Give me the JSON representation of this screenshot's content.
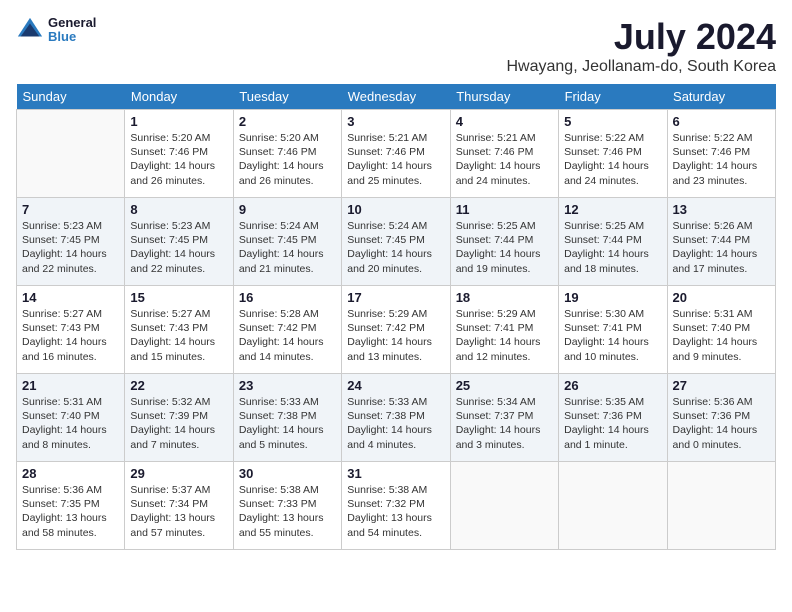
{
  "logo": {
    "line1": "General",
    "line2": "Blue"
  },
  "title": "July 2024",
  "location": "Hwayang, Jeollanam-do, South Korea",
  "weekdays": [
    "Sunday",
    "Monday",
    "Tuesday",
    "Wednesday",
    "Thursday",
    "Friday",
    "Saturday"
  ],
  "weeks": [
    [
      {
        "day": "",
        "info": ""
      },
      {
        "day": "1",
        "info": "Sunrise: 5:20 AM\nSunset: 7:46 PM\nDaylight: 14 hours\nand 26 minutes."
      },
      {
        "day": "2",
        "info": "Sunrise: 5:20 AM\nSunset: 7:46 PM\nDaylight: 14 hours\nand 26 minutes."
      },
      {
        "day": "3",
        "info": "Sunrise: 5:21 AM\nSunset: 7:46 PM\nDaylight: 14 hours\nand 25 minutes."
      },
      {
        "day": "4",
        "info": "Sunrise: 5:21 AM\nSunset: 7:46 PM\nDaylight: 14 hours\nand 24 minutes."
      },
      {
        "day": "5",
        "info": "Sunrise: 5:22 AM\nSunset: 7:46 PM\nDaylight: 14 hours\nand 24 minutes."
      },
      {
        "day": "6",
        "info": "Sunrise: 5:22 AM\nSunset: 7:46 PM\nDaylight: 14 hours\nand 23 minutes."
      }
    ],
    [
      {
        "day": "7",
        "info": "Sunrise: 5:23 AM\nSunset: 7:45 PM\nDaylight: 14 hours\nand 22 minutes."
      },
      {
        "day": "8",
        "info": "Sunrise: 5:23 AM\nSunset: 7:45 PM\nDaylight: 14 hours\nand 22 minutes."
      },
      {
        "day": "9",
        "info": "Sunrise: 5:24 AM\nSunset: 7:45 PM\nDaylight: 14 hours\nand 21 minutes."
      },
      {
        "day": "10",
        "info": "Sunrise: 5:24 AM\nSunset: 7:45 PM\nDaylight: 14 hours\nand 20 minutes."
      },
      {
        "day": "11",
        "info": "Sunrise: 5:25 AM\nSunset: 7:44 PM\nDaylight: 14 hours\nand 19 minutes."
      },
      {
        "day": "12",
        "info": "Sunrise: 5:25 AM\nSunset: 7:44 PM\nDaylight: 14 hours\nand 18 minutes."
      },
      {
        "day": "13",
        "info": "Sunrise: 5:26 AM\nSunset: 7:44 PM\nDaylight: 14 hours\nand 17 minutes."
      }
    ],
    [
      {
        "day": "14",
        "info": "Sunrise: 5:27 AM\nSunset: 7:43 PM\nDaylight: 14 hours\nand 16 minutes."
      },
      {
        "day": "15",
        "info": "Sunrise: 5:27 AM\nSunset: 7:43 PM\nDaylight: 14 hours\nand 15 minutes."
      },
      {
        "day": "16",
        "info": "Sunrise: 5:28 AM\nSunset: 7:42 PM\nDaylight: 14 hours\nand 14 minutes."
      },
      {
        "day": "17",
        "info": "Sunrise: 5:29 AM\nSunset: 7:42 PM\nDaylight: 14 hours\nand 13 minutes."
      },
      {
        "day": "18",
        "info": "Sunrise: 5:29 AM\nSunset: 7:41 PM\nDaylight: 14 hours\nand 12 minutes."
      },
      {
        "day": "19",
        "info": "Sunrise: 5:30 AM\nSunset: 7:41 PM\nDaylight: 14 hours\nand 10 minutes."
      },
      {
        "day": "20",
        "info": "Sunrise: 5:31 AM\nSunset: 7:40 PM\nDaylight: 14 hours\nand 9 minutes."
      }
    ],
    [
      {
        "day": "21",
        "info": "Sunrise: 5:31 AM\nSunset: 7:40 PM\nDaylight: 14 hours\nand 8 minutes."
      },
      {
        "day": "22",
        "info": "Sunrise: 5:32 AM\nSunset: 7:39 PM\nDaylight: 14 hours\nand 7 minutes."
      },
      {
        "day": "23",
        "info": "Sunrise: 5:33 AM\nSunset: 7:38 PM\nDaylight: 14 hours\nand 5 minutes."
      },
      {
        "day": "24",
        "info": "Sunrise: 5:33 AM\nSunset: 7:38 PM\nDaylight: 14 hours\nand 4 minutes."
      },
      {
        "day": "25",
        "info": "Sunrise: 5:34 AM\nSunset: 7:37 PM\nDaylight: 14 hours\nand 3 minutes."
      },
      {
        "day": "26",
        "info": "Sunrise: 5:35 AM\nSunset: 7:36 PM\nDaylight: 14 hours\nand 1 minute."
      },
      {
        "day": "27",
        "info": "Sunrise: 5:36 AM\nSunset: 7:36 PM\nDaylight: 14 hours\nand 0 minutes."
      }
    ],
    [
      {
        "day": "28",
        "info": "Sunrise: 5:36 AM\nSunset: 7:35 PM\nDaylight: 13 hours\nand 58 minutes."
      },
      {
        "day": "29",
        "info": "Sunrise: 5:37 AM\nSunset: 7:34 PM\nDaylight: 13 hours\nand 57 minutes."
      },
      {
        "day": "30",
        "info": "Sunrise: 5:38 AM\nSunset: 7:33 PM\nDaylight: 13 hours\nand 55 minutes."
      },
      {
        "day": "31",
        "info": "Sunrise: 5:38 AM\nSunset: 7:32 PM\nDaylight: 13 hours\nand 54 minutes."
      },
      {
        "day": "",
        "info": ""
      },
      {
        "day": "",
        "info": ""
      },
      {
        "day": "",
        "info": ""
      }
    ]
  ]
}
